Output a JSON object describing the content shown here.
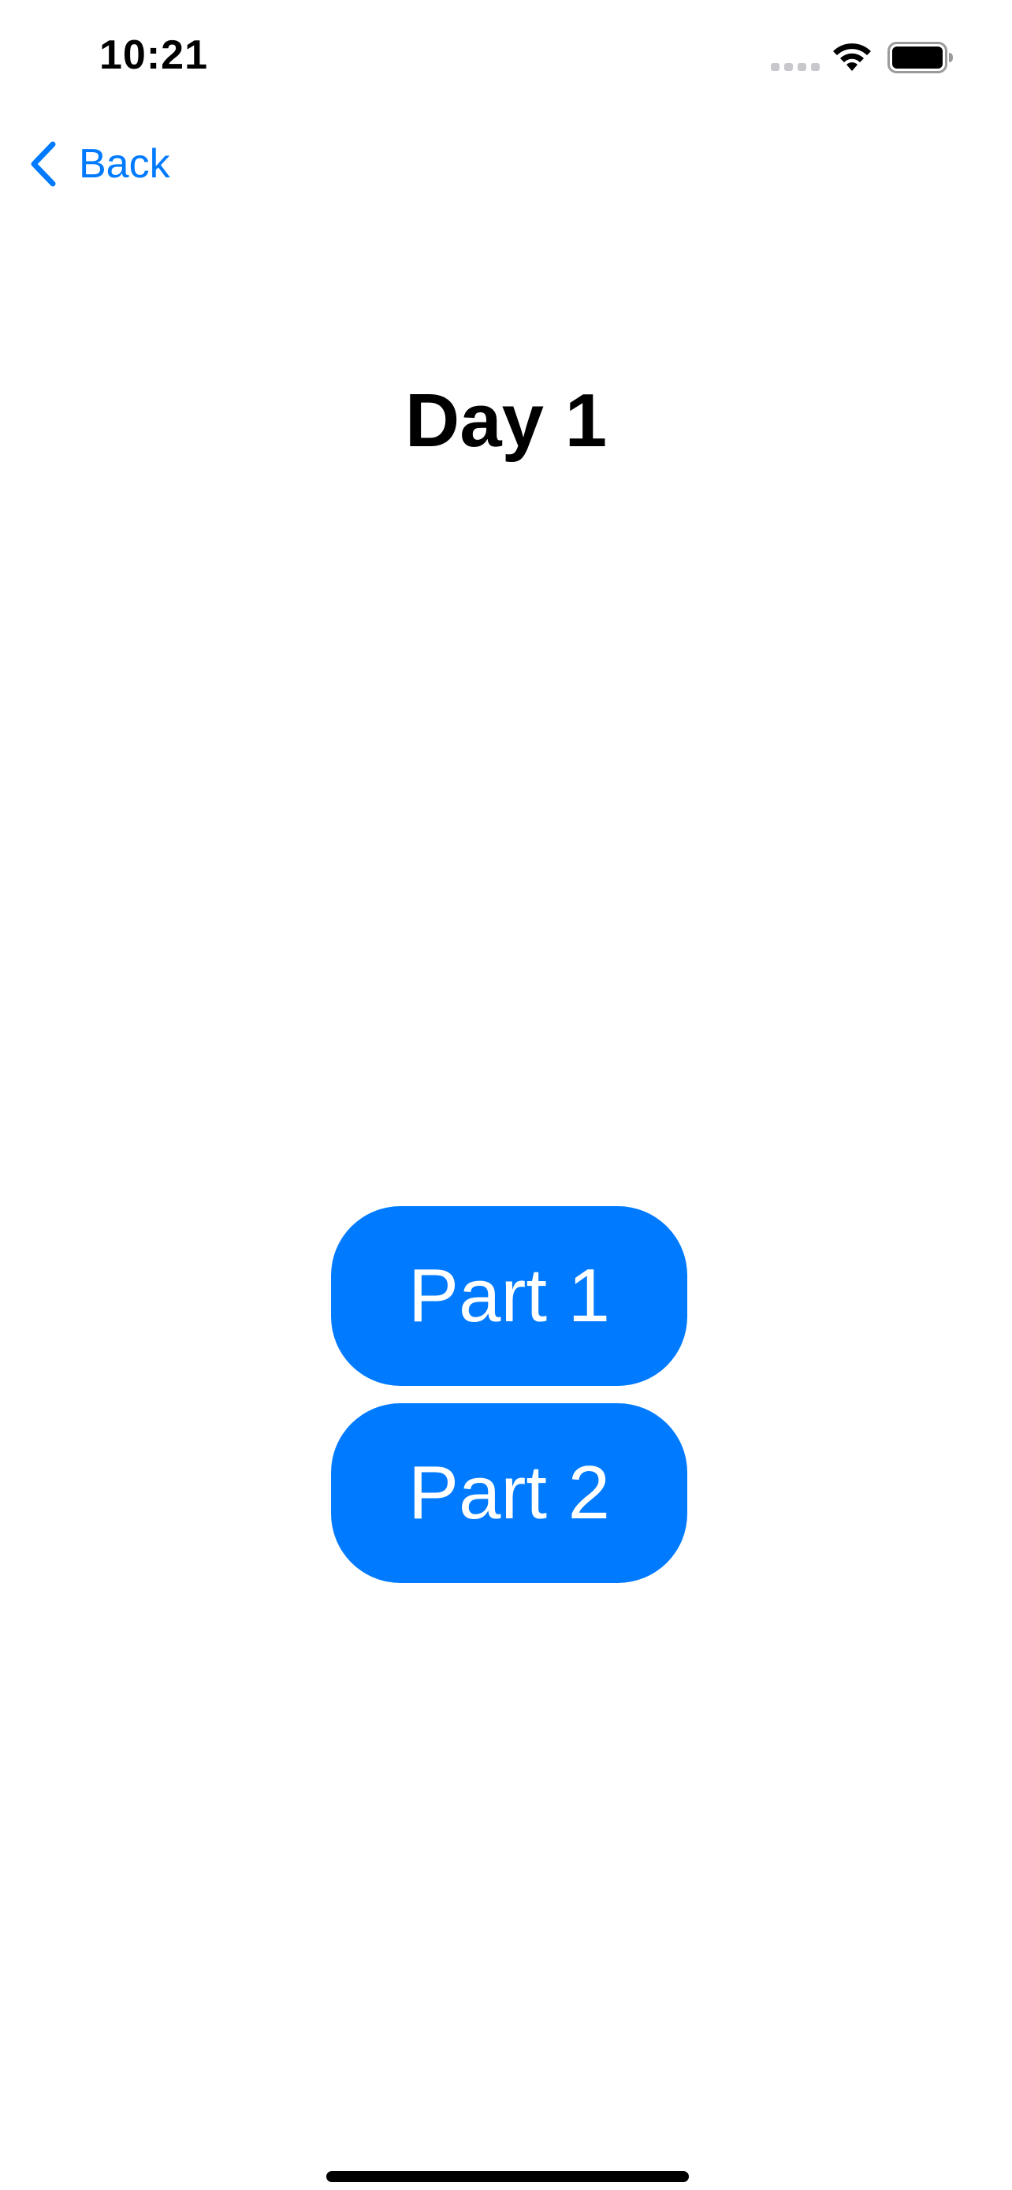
{
  "status_bar": {
    "time": "10:21",
    "icons": [
      "cellular-signal-icon",
      "wifi-icon",
      "battery-icon"
    ]
  },
  "nav": {
    "back_label": "Back",
    "back_icon": "chevron-left-icon"
  },
  "page": {
    "title": "Day 1"
  },
  "buttons": [
    {
      "label": "Part 1"
    },
    {
      "label": "Part 2"
    }
  ],
  "colors": {
    "accent": "#007aff",
    "background": "#ffffff",
    "text": "#000000",
    "button_text": "#ffffff",
    "inactive_signal": "#c7c7cc"
  }
}
